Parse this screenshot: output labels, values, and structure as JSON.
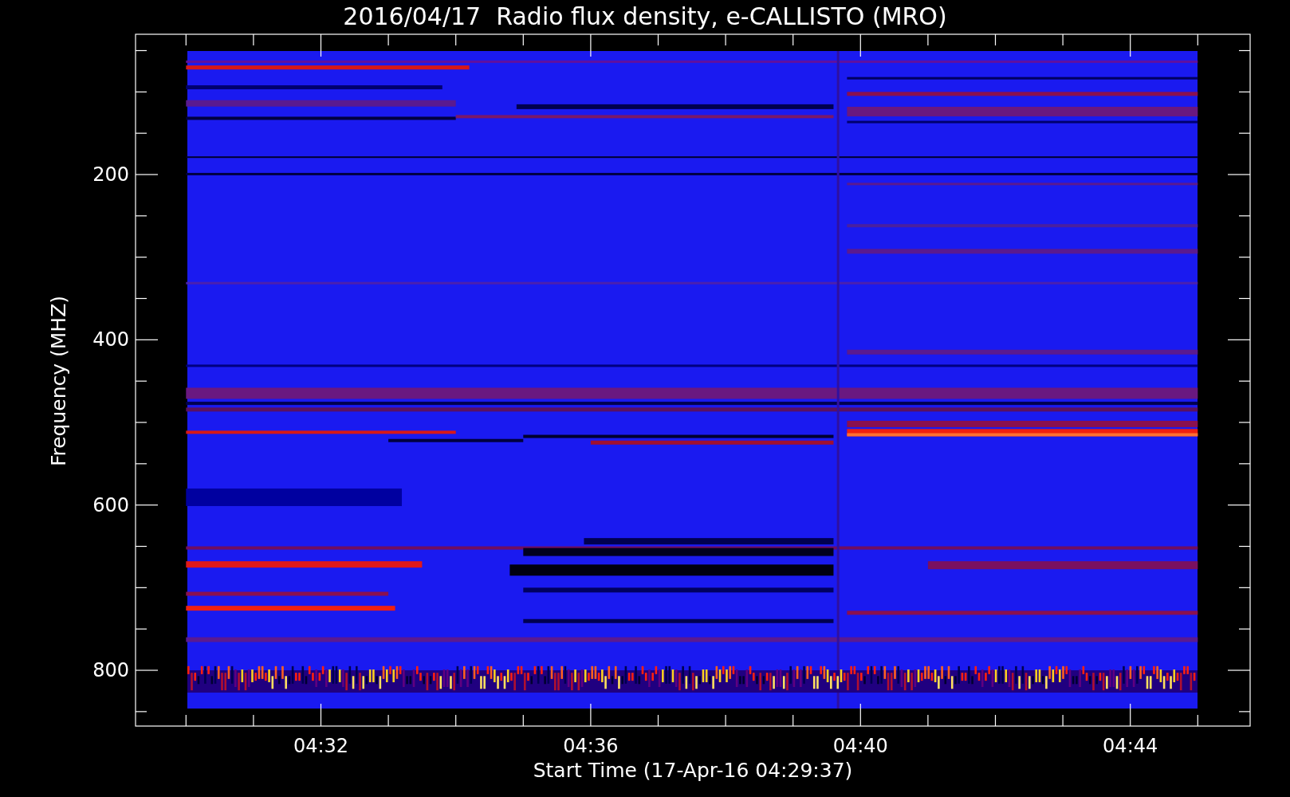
{
  "title": "2016/04/17  Radio flux density, e-CALLISTO (MRO)",
  "x_axis": {
    "label": "Start Time (17-Apr-16 04:29:37)",
    "ticks": [
      "04:32",
      "04:36",
      "04:40",
      "04:44"
    ]
  },
  "y_axis": {
    "label": "Frequency (MHZ)",
    "ticks": [
      "200",
      "400",
      "600",
      "800"
    ]
  }
}
